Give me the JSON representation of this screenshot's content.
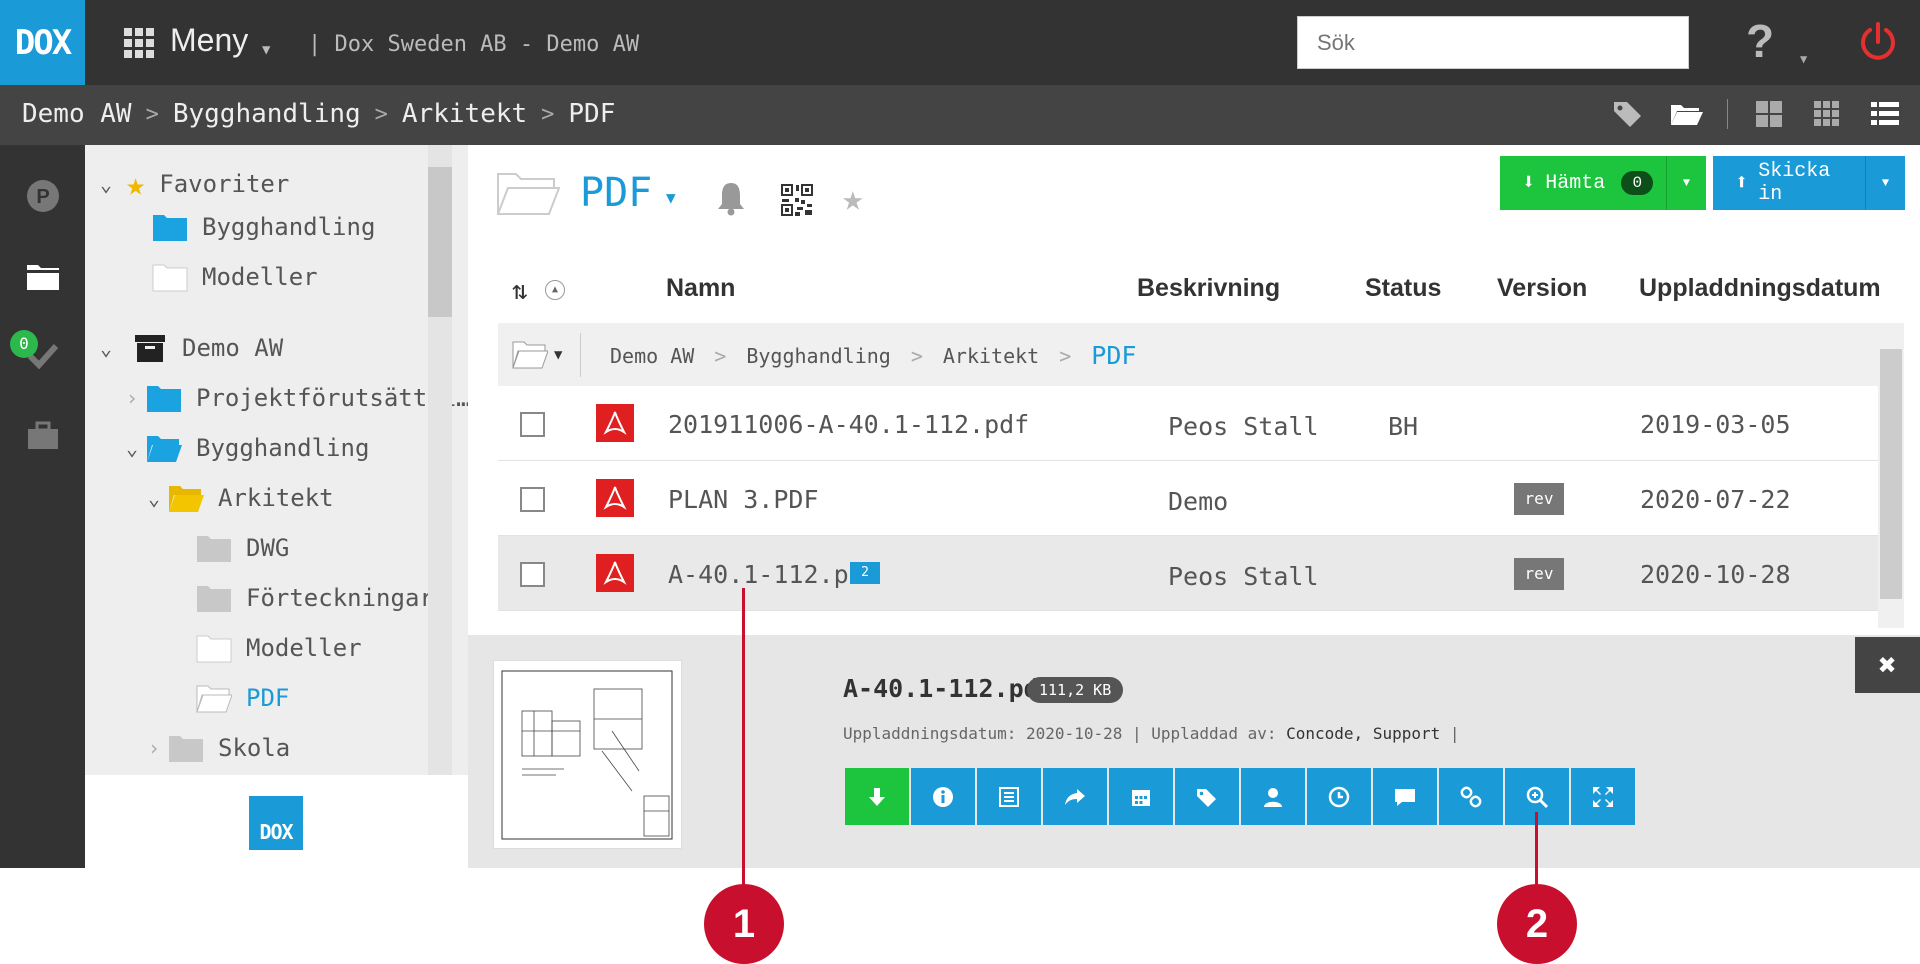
{
  "app": {
    "logo": "DOX",
    "menu_label": "Meny",
    "company": "| Dox Sweden AB - Demo AW",
    "search_placeholder": "Sök",
    "help": "?"
  },
  "breadcrumb": [
    "Demo AW",
    "Bygghandling",
    "Arkitekt",
    "PDF"
  ],
  "tree": {
    "favorites_label": "Favoriter",
    "favorites": [
      "Bygghandling",
      "Modeller"
    ],
    "root": "Demo AW",
    "items": [
      "Projektförutsättni…",
      "Bygghandling",
      "Arkitekt",
      "DWG",
      "Förteckningar",
      "Modeller",
      "PDF",
      "Skola"
    ],
    "badge": "0",
    "footer_logo": "DOX"
  },
  "folder": {
    "title": "PDF"
  },
  "buttons": {
    "download": "Hämta",
    "download_count": "0",
    "upload": "Skicka in"
  },
  "table": {
    "columns": [
      "Namn",
      "Beskrivning",
      "Status",
      "Version",
      "Uppladdningsdatum"
    ],
    "path": [
      "Demo AW",
      "Bygghandling",
      "Arkitekt",
      "PDF"
    ],
    "rows": [
      {
        "name": "201911006-A-40.1-112.pdf",
        "description": "Peos Stall",
        "status": "BH",
        "version": "",
        "date": "2019-03-05"
      },
      {
        "name": "PLAN 3.PDF",
        "description": "Demo",
        "status": "",
        "version": "rev",
        "date": "2020-07-22"
      },
      {
        "name": "A-40.1-112.pdf",
        "description": "Peos Stall",
        "status": "",
        "version": "rev",
        "date": "2020-10-28",
        "comments": "2"
      }
    ]
  },
  "detail": {
    "name": "A-40.1-112.pdf",
    "size": "111,2 KB",
    "meta_prefix": "Uppladdningsdatum: 2020-10-28 | Uppladdad av:",
    "meta_user": "Concode, Support",
    "meta_suffix": "|"
  },
  "callouts": [
    "1",
    "2"
  ],
  "colors": {
    "accent": "#1a9ad6",
    "success": "#1dc43d",
    "danger": "#e02020",
    "callout": "#c8102e",
    "dark": "#333333"
  }
}
